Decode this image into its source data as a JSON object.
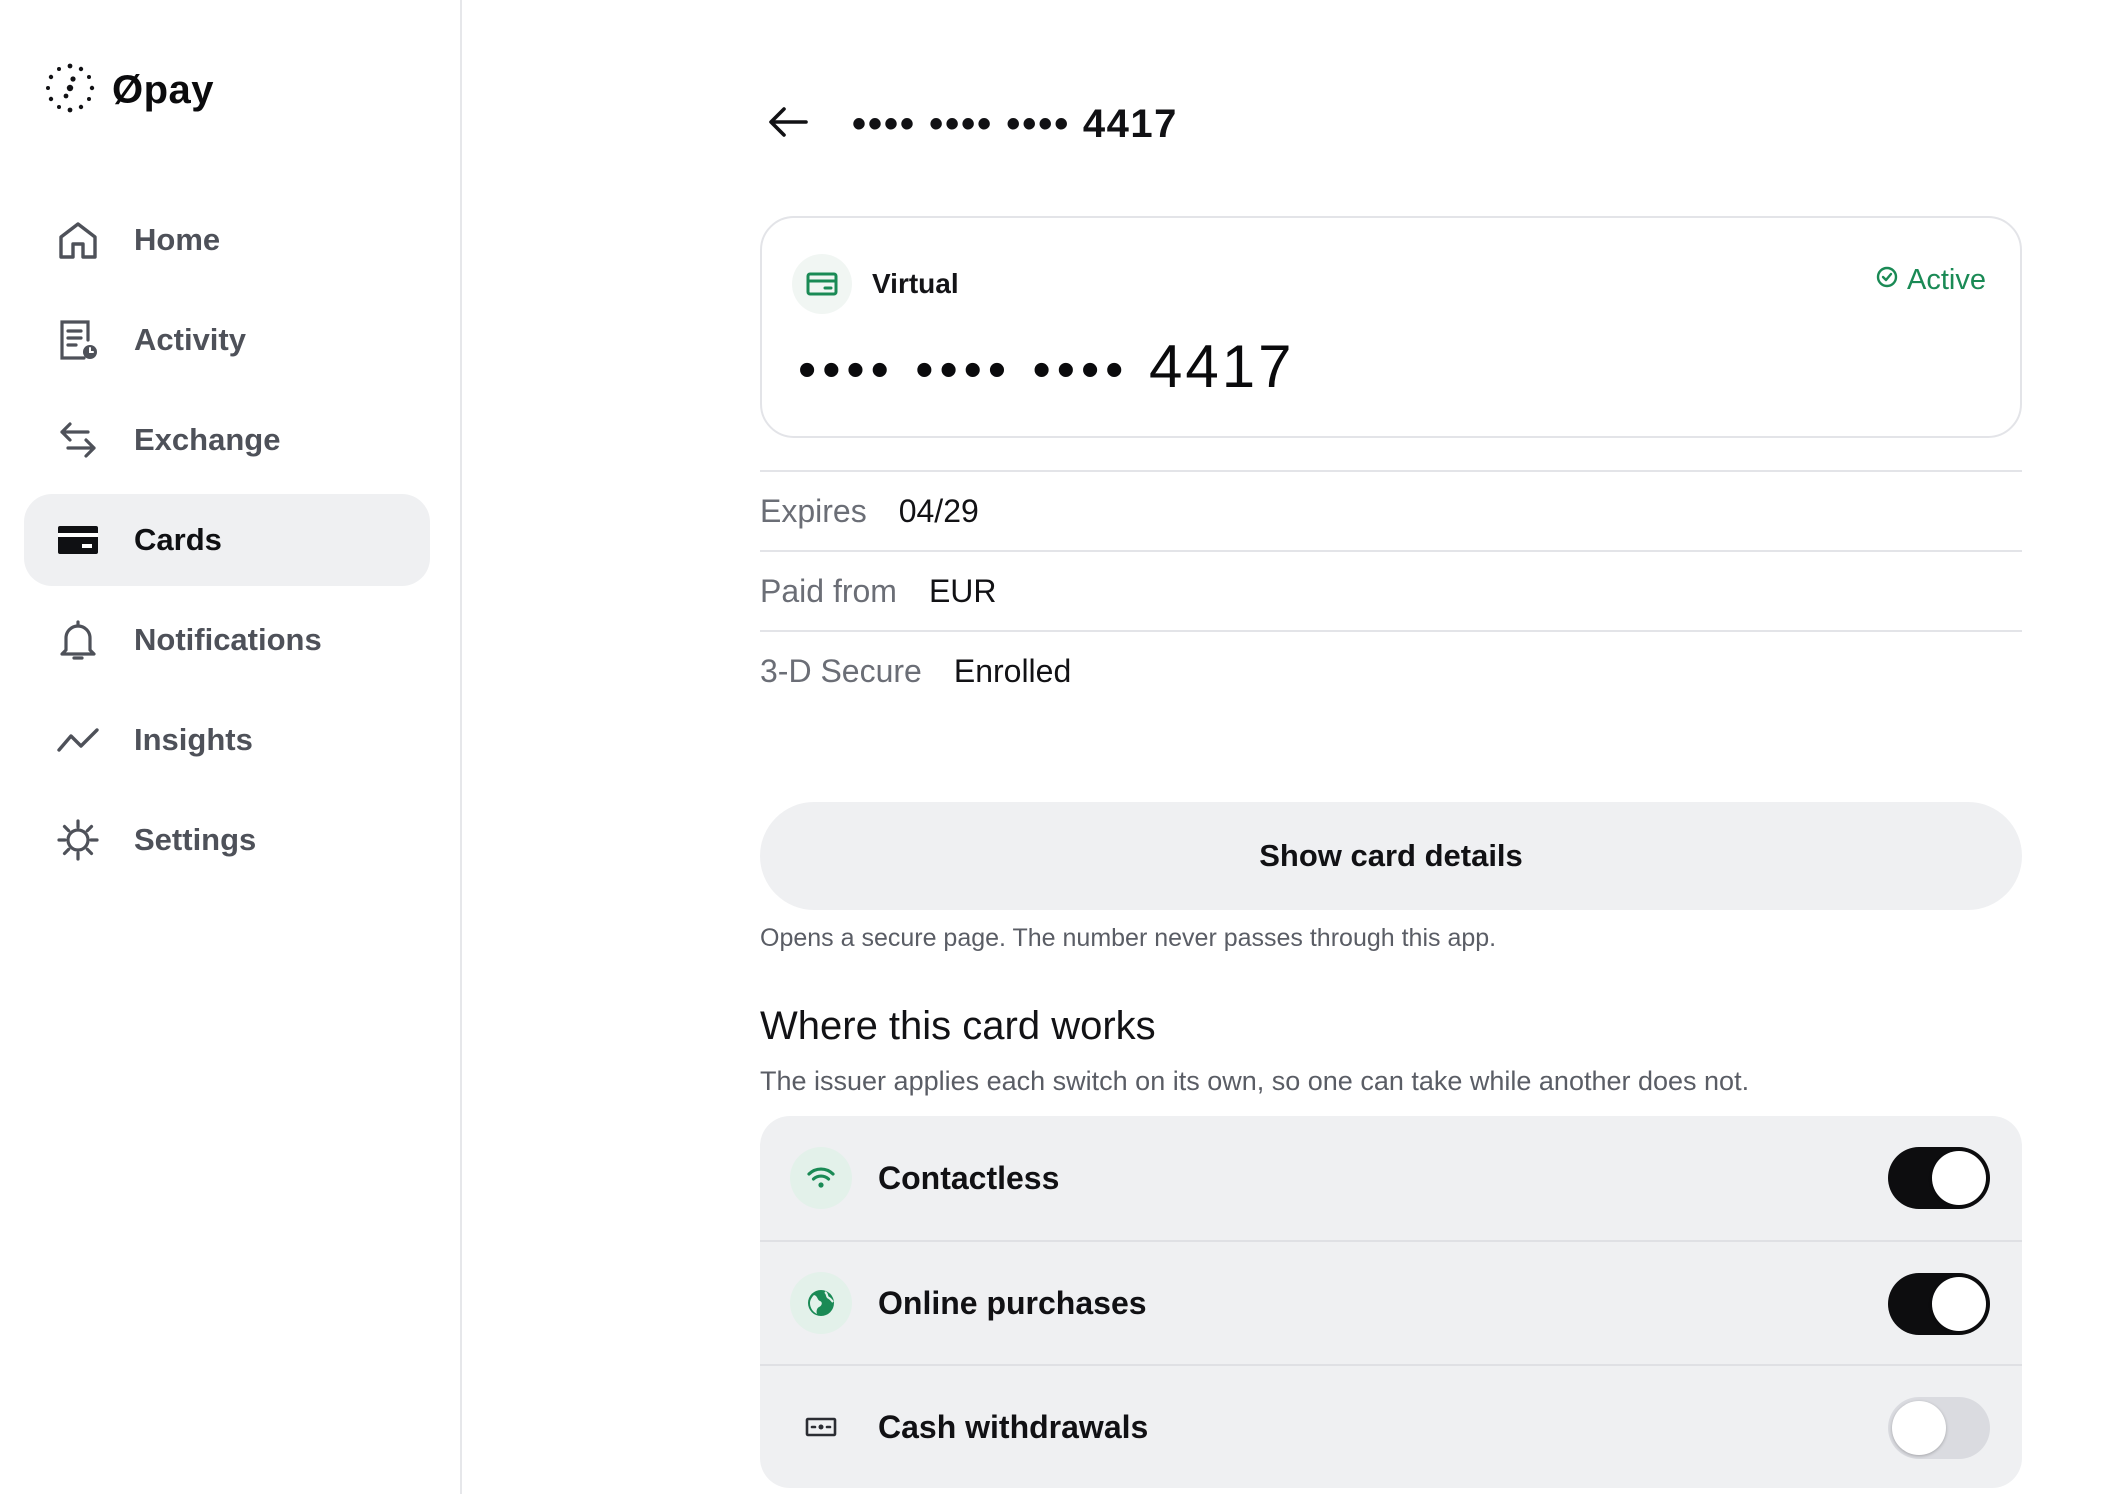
{
  "brand": {
    "name": "Øpay",
    "logo_icon": "dotted-ring-logo"
  },
  "sidebar": {
    "items": [
      {
        "label": "Home",
        "icon": "home-icon",
        "active": false
      },
      {
        "label": "Activity",
        "icon": "activity-icon",
        "active": false
      },
      {
        "label": "Exchange",
        "icon": "exchange-icon",
        "active": false
      },
      {
        "label": "Cards",
        "icon": "card-icon",
        "active": true
      },
      {
        "label": "Notifications",
        "icon": "bell-icon",
        "active": false
      },
      {
        "label": "Insights",
        "icon": "trend-icon",
        "active": false
      },
      {
        "label": "Settings",
        "icon": "gear-icon",
        "active": false
      }
    ]
  },
  "header": {
    "masked": "•••• •••• ••••",
    "last4": "4417",
    "back_icon": "arrow-left-icon"
  },
  "card": {
    "type": "Virtual",
    "status": "Active",
    "masked": "•••• •••• ••••",
    "last4": "4417",
    "accent_color": "#1a8a55"
  },
  "details": [
    {
      "key": "Expires",
      "value": "04/29"
    },
    {
      "key": "Paid from",
      "value": "EUR"
    },
    {
      "key": "3-D Secure",
      "value": "Enrolled"
    }
  ],
  "show_details": {
    "label": "Show card details",
    "note": "Opens a secure page. The number never passes through this app."
  },
  "section": {
    "title": "Where this card works",
    "subtitle": "The issuer applies each switch on its own, so one can take while another does not."
  },
  "toggles": [
    {
      "label": "Contactless",
      "icon": "contactless-icon",
      "on": true
    },
    {
      "label": "Online purchases",
      "icon": "globe-icon",
      "on": true
    },
    {
      "label": "Cash withdrawals",
      "icon": "cash-icon",
      "on": false
    }
  ]
}
